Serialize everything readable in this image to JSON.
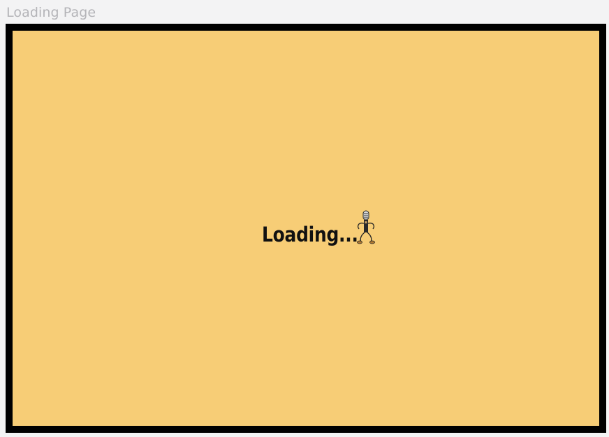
{
  "page": {
    "title": "Loading Page"
  },
  "loader": {
    "text": "Loading...",
    "mascot_icon": "microphone-character-icon"
  },
  "colors": {
    "canvas_bg": "#f7cd76",
    "frame_border": "#000000",
    "page_bg": "#f3f3f4",
    "title_text": "#b4b4b8"
  }
}
